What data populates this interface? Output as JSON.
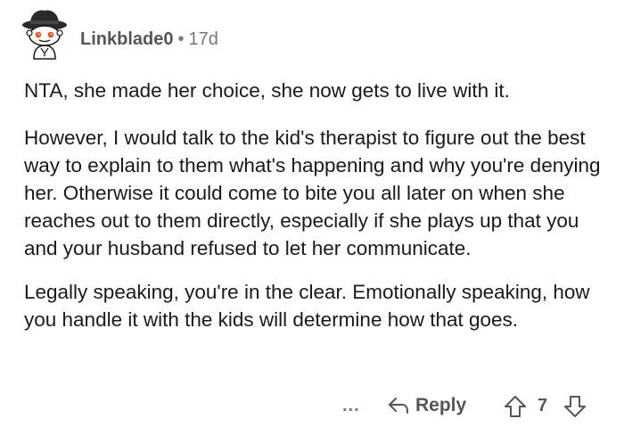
{
  "comment": {
    "author": "Linkblade0",
    "separator": "•",
    "age": "17d",
    "paragraphs": [
      "NTA, she made her choice, she now gets to live with it.",
      "However, I would talk to the kid's therapist to figure out the best way to explain to them what's happening and why you're denying her.  Otherwise it could come to bite you all later on when she reaches out to them directly, especially if she plays up that you and your husband refused to let her communicate.",
      "Legally speaking, you're in the clear.  Emotionally speaking, how you handle it with the kids will determine how that goes."
    ]
  },
  "actions": {
    "more_label": "...",
    "reply_label": "Reply",
    "vote_count": "7"
  },
  "icons": {
    "avatar": "snoo-avatar-icon",
    "reply": "reply-arrow-icon",
    "upvote": "upvote-arrow-icon",
    "downvote": "downvote-arrow-icon"
  },
  "colors": {
    "meta_text": "#777777",
    "username": "#555555",
    "body_text": "#1a1a1b"
  }
}
